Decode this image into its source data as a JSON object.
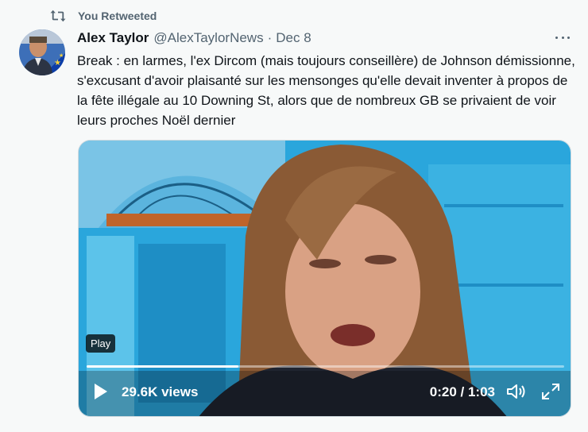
{
  "retweet": {
    "label": "You Retweeted",
    "icon": "retweet-icon"
  },
  "tweet": {
    "author_name": "Alex Taylor",
    "handle": "@AlexTaylorNews",
    "separator": "·",
    "date": "Dec 8",
    "text": "Break : en larmes, l'ex Dircom (mais toujours conseillère) de Johnson démissionne, s'excusant d'avoir plaisanté sur les mensonges qu'elle devait inventer à propos de la fête illégale au 10 Downing St, alors que de nombreux GB se privaient de voir leurs proches Noël dernier"
  },
  "video": {
    "play_badge": "Play",
    "views": "29.6K views",
    "time": "0:20 / 1:03",
    "progress_percent": 31.7
  },
  "colors": {
    "secondary_text": "#536471",
    "video_bg": "#2aa6dc"
  }
}
